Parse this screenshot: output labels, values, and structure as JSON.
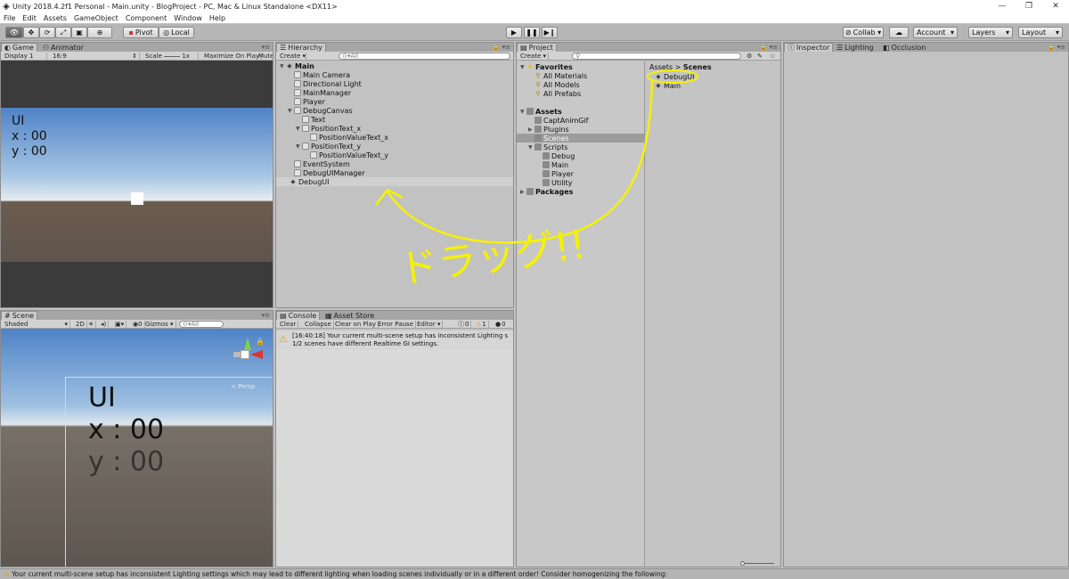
{
  "window": {
    "title": "Unity 2018.4.2f1 Personal - Main.unity - BlogProject - PC, Mac & Linux Standalone <DX11>"
  },
  "menu": [
    "File",
    "Edit",
    "Assets",
    "GameObject",
    "Component",
    "Window",
    "Help"
  ],
  "toolbar": {
    "pivot": "Pivot",
    "local": "Local",
    "collab": "Collab",
    "account": "Account",
    "layers": "Layers",
    "layout": "Layout"
  },
  "game": {
    "tab_game": "Game",
    "tab_animator": "Animator",
    "display": "Display 1",
    "aspect": "16:9",
    "scale_label": "Scale",
    "scale_value": "1x",
    "maximize": "Maximize On Play",
    "mute": "Mute",
    "ui_lines": [
      "UI",
      "x : 00",
      "y : 00"
    ]
  },
  "scene": {
    "tab": "Scene",
    "shading": "Shaded",
    "mode2d": "2D",
    "gizmos": "Gizmos",
    "search_placeholder": "All",
    "persp": "< Persp",
    "ui_lines": [
      "UI",
      "x : 00",
      "y : 00"
    ]
  },
  "hierarchy": {
    "tab": "Hierarchy",
    "create": "Create",
    "search_placeholder": "All",
    "items": [
      {
        "label": "Main",
        "level": 0,
        "kind": "scene",
        "expanded": true
      },
      {
        "label": "Main Camera",
        "level": 1,
        "kind": "object"
      },
      {
        "label": "Directional Light",
        "level": 1,
        "kind": "object"
      },
      {
        "label": "MainManager",
        "level": 1,
        "kind": "object"
      },
      {
        "label": "Player",
        "level": 1,
        "kind": "object"
      },
      {
        "label": "DebugCanvas",
        "level": 1,
        "kind": "object",
        "expanded": true
      },
      {
        "label": "Text",
        "level": 2,
        "kind": "object"
      },
      {
        "label": "PositionText_x",
        "level": 2,
        "kind": "object",
        "expanded": true
      },
      {
        "label": "PositionValueText_x",
        "level": 3,
        "kind": "object"
      },
      {
        "label": "PositionText_y",
        "level": 2,
        "kind": "object",
        "expanded": true
      },
      {
        "label": "PositionValueText_y",
        "level": 3,
        "kind": "object"
      },
      {
        "label": "EventSystem",
        "level": 1,
        "kind": "object"
      },
      {
        "label": "DebugUIManager",
        "level": 1,
        "kind": "object"
      },
      {
        "label": "DebugUI",
        "level": 0,
        "kind": "scene-dropped"
      }
    ]
  },
  "project": {
    "tab": "Project",
    "create": "Create",
    "breadcrumb_root": "Assets",
    "breadcrumb_current": "Scenes",
    "tree": [
      {
        "label": "Favorites",
        "level": 0,
        "kind": "fav-header"
      },
      {
        "label": "All Materials",
        "level": 1,
        "kind": "fav"
      },
      {
        "label": "All Models",
        "level": 1,
        "kind": "fav"
      },
      {
        "label": "All Prefabs",
        "level": 1,
        "kind": "fav"
      },
      {
        "label": "Assets",
        "level": 0,
        "kind": "folder-header"
      },
      {
        "label": "CaptAnimGif",
        "level": 1,
        "kind": "folder"
      },
      {
        "label": "Plugins",
        "level": 1,
        "kind": "folder",
        "collapsed": true
      },
      {
        "label": "Scenes",
        "level": 1,
        "kind": "folder",
        "selected": true
      },
      {
        "label": "Scripts",
        "level": 1,
        "kind": "folder",
        "expanded": true
      },
      {
        "label": "Debug",
        "level": 2,
        "kind": "folder"
      },
      {
        "label": "Main",
        "level": 2,
        "kind": "folder"
      },
      {
        "label": "Player",
        "level": 2,
        "kind": "folder"
      },
      {
        "label": "Utility",
        "level": 2,
        "kind": "folder"
      },
      {
        "label": "Packages",
        "level": 0,
        "kind": "folder-header",
        "collapsed": true
      }
    ],
    "files": [
      "DebugUI",
      "Main"
    ]
  },
  "console": {
    "tab": "Console",
    "tab_store": "Asset Store",
    "buttons": [
      "Clear",
      "Collapse",
      "Clear on Play",
      "Error Pause",
      "Editor"
    ],
    "count_log": "0",
    "count_warn": "1",
    "count_err": "0",
    "messages": [
      "[16:40:18] Your current multi-scene setup has inconsistent Lighting s",
      "1/2 scenes have different Realtime GI settings."
    ]
  },
  "inspector": {
    "tab": "Inspector",
    "tab_lighting": "Lighting",
    "tab_occlusion": "Occlusion"
  },
  "annotation": {
    "text": "ドラッグ!!",
    "color": "#f5f200"
  },
  "status": "Your current multi-scene setup has inconsistent Lighting settings which may lead to different lighting when loading scenes individually or in a different order! Consider homogenizing the following:"
}
